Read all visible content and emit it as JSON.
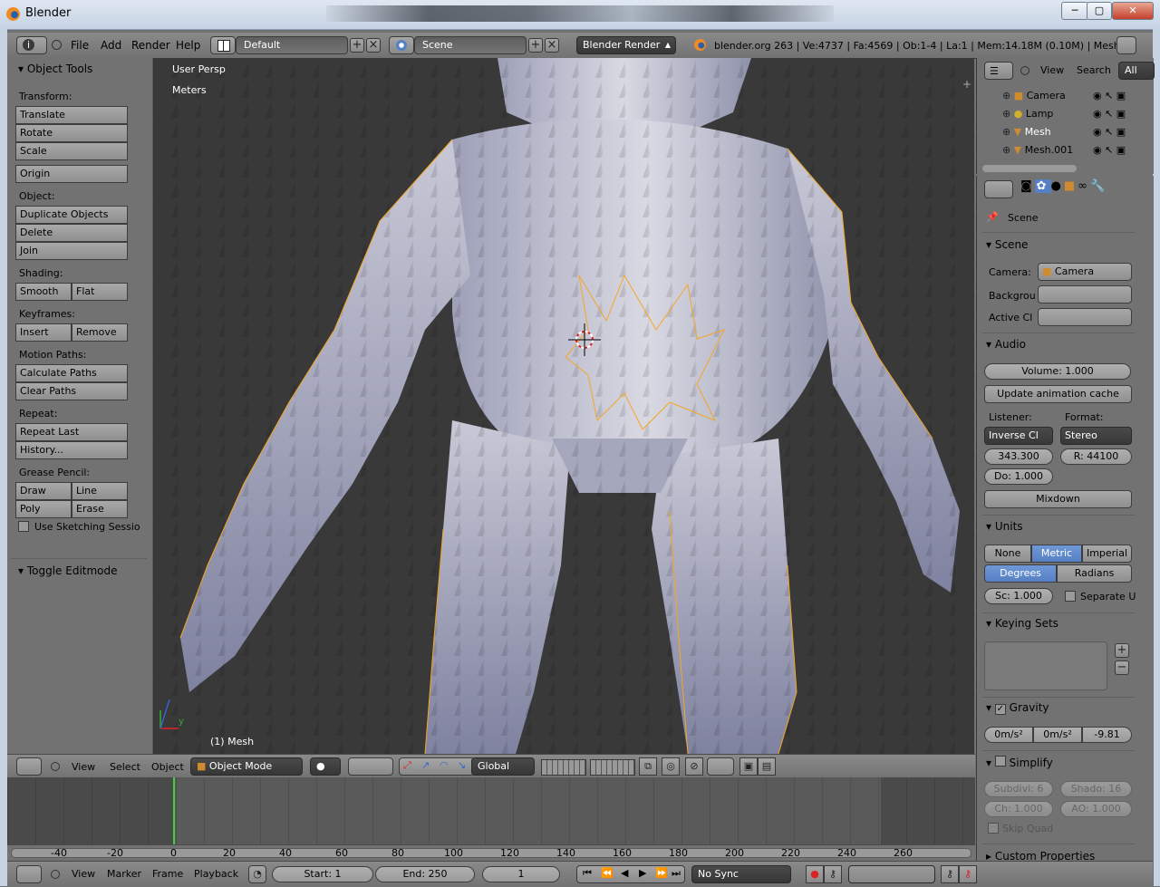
{
  "window": {
    "title": "Blender",
    "minimize": "─",
    "maximize": "▢",
    "close": "✕"
  },
  "top_header": {
    "menus": [
      "File",
      "Add",
      "Render",
      "Help"
    ],
    "layout": "Default",
    "scene": "Scene",
    "engine": "Blender Render",
    "stats": "blender.org 263 | Ve:4737 | Fa:4569 | Ob:1-4 | La:1 | Mem:14.18M (0.10M) | Mesh"
  },
  "toolshelf": {
    "title": "Object Tools",
    "transform_label": "Transform:",
    "translate": "Translate",
    "rotate": "Rotate",
    "scale": "Scale",
    "origin": "Origin",
    "object_label": "Object:",
    "duplicate": "Duplicate Objects",
    "delete": "Delete",
    "join": "Join",
    "shading_label": "Shading:",
    "smooth": "Smooth",
    "flat": "Flat",
    "keyframes_label": "Keyframes:",
    "insert": "Insert",
    "remove": "Remove",
    "motion_label": "Motion Paths:",
    "calc_paths": "Calculate Paths",
    "clear_paths": "Clear Paths",
    "repeat_label": "Repeat:",
    "repeat_last": "Repeat Last",
    "history": "History...",
    "grease_label": "Grease Pencil:",
    "draw": "Draw",
    "line": "Line",
    "poly": "Poly",
    "erase": "Erase",
    "sketching": "Use Sketching Sessio",
    "toggle_editmode": "Toggle Editmode"
  },
  "viewport": {
    "persp": "User Persp",
    "units": "Meters",
    "object_label": "(1) Mesh",
    "axis_y": "y"
  },
  "outliner": {
    "menus": [
      "View",
      "Search"
    ],
    "filter": "All Sce",
    "items": [
      "Camera",
      "Lamp",
      "Mesh",
      "Mesh.001"
    ]
  },
  "properties": {
    "context": "Scene",
    "scene_panel": "Scene",
    "camera_label": "Camera:",
    "camera_value": "Camera",
    "background_label": "Backgrou",
    "active_clip_label": "Active Cl",
    "audio_panel": "Audio",
    "volume": "Volume: 1.000",
    "update_cache": "Update animation cache",
    "listener_label": "Listener:",
    "format_label": "Format:",
    "listener_value": "Inverse Cl",
    "format_value": "Stereo",
    "speed": "343.300",
    "rate": "R: 44100",
    "doppler": "Do: 1.000",
    "mixdown": "Mixdown",
    "units_panel": "Units",
    "unit_none": "None",
    "unit_metric": "Metric",
    "unit_imperial": "Imperial",
    "degrees": "Degrees",
    "radians": "Radians",
    "scale": "Sc: 1.000",
    "separate": "Separate U",
    "keying_panel": "Keying Sets",
    "gravity_panel": "Gravity",
    "grav_x": "0m/s²",
    "grav_y": "0m/s²",
    "grav_z": "-9.81",
    "simplify_panel": "Simplify",
    "subdiv": "Subdivi: 6",
    "shadow": "Shado: 16",
    "child": "Ch: 1.000",
    "ao": "AO: 1.000",
    "skip_quad": "Skip Quad",
    "custom_props": "Custom Properties"
  },
  "view3d_header": {
    "menus": [
      "View",
      "Select",
      "Object"
    ],
    "mode": "Object Mode",
    "orientation": "Global"
  },
  "timeline": {
    "ticks": [
      "-40",
      "-20",
      "0",
      "20",
      "40",
      "60",
      "80",
      "100",
      "120",
      "140",
      "160",
      "180",
      "200",
      "220",
      "240",
      "260"
    ],
    "menus": [
      "View",
      "Marker",
      "Frame",
      "Playback"
    ],
    "start": "Start: 1",
    "end": "End: 250",
    "current": "1",
    "sync": "No Sync"
  },
  "colors": {
    "accent_blue": "#5680c4",
    "selection_orange": "#f5a623",
    "frame_marker": "#3fd03f"
  }
}
